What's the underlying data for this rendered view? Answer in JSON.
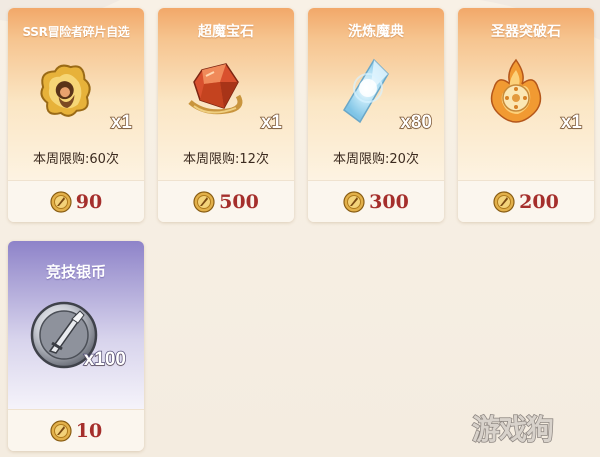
{
  "shop_items": [
    {
      "title": "SSR冒险者碎片自选",
      "quantity": "x1",
      "limit": "本周限购:60次",
      "price": "90",
      "icon": "ssr-adventurer-shard-icon"
    },
    {
      "title": "超魔宝石",
      "quantity": "x1",
      "limit": "本周限购:12次",
      "price": "500",
      "icon": "super-magic-gem-icon"
    },
    {
      "title": "洗炼魔典",
      "quantity": "x80",
      "limit": "本周限购:20次",
      "price": "300",
      "icon": "refining-grimoire-icon"
    },
    {
      "title": "圣器突破石",
      "quantity": "x1",
      "limit": "",
      "price": "200",
      "icon": "holy-relic-breakthrough-stone-icon"
    },
    {
      "title": "竞技银币",
      "quantity": "x100",
      "limit": "",
      "price": "10",
      "icon": "arena-silver-coin-icon"
    }
  ],
  "currency_icon": "arena-token-coin-icon",
  "watermark": "游戏狗",
  "colors": {
    "gold_header": "#f2a869",
    "purple_header": "#8e83c9",
    "price_text": "#a52f2c",
    "card_bg": "#fdf6ea"
  }
}
